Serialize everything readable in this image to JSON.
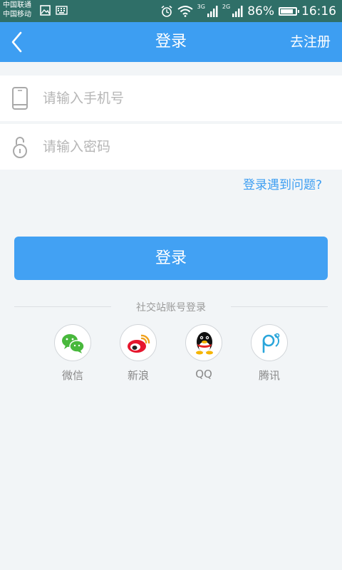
{
  "status_bar": {
    "carrier_1": "中国联通",
    "carrier_2": "中国移动",
    "net_3g": "3G",
    "net_2g": "2G",
    "battery": "86%",
    "battery_level": 0.86,
    "time": "16:16",
    "icons": [
      "image-icon",
      "keyboard-icon",
      "alarm-icon",
      "wifi-icon",
      "signal-icon",
      "battery-icon"
    ]
  },
  "header": {
    "title": "登录",
    "register": "去注册",
    "background": "#3d9ef2"
  },
  "form": {
    "phone_placeholder": "请输入手机号",
    "password_placeholder": "请输入密码",
    "trouble_link": "登录遇到问题?",
    "login_button": "登录"
  },
  "social": {
    "title": "社交站账号登录",
    "items": [
      {
        "label": "微信",
        "icon": "wechat-icon"
      },
      {
        "label": "新浪",
        "icon": "weibo-icon"
      },
      {
        "label": "QQ",
        "icon": "qq-icon"
      },
      {
        "label": "腾讯",
        "icon": "tencent-weibo-icon"
      }
    ]
  }
}
